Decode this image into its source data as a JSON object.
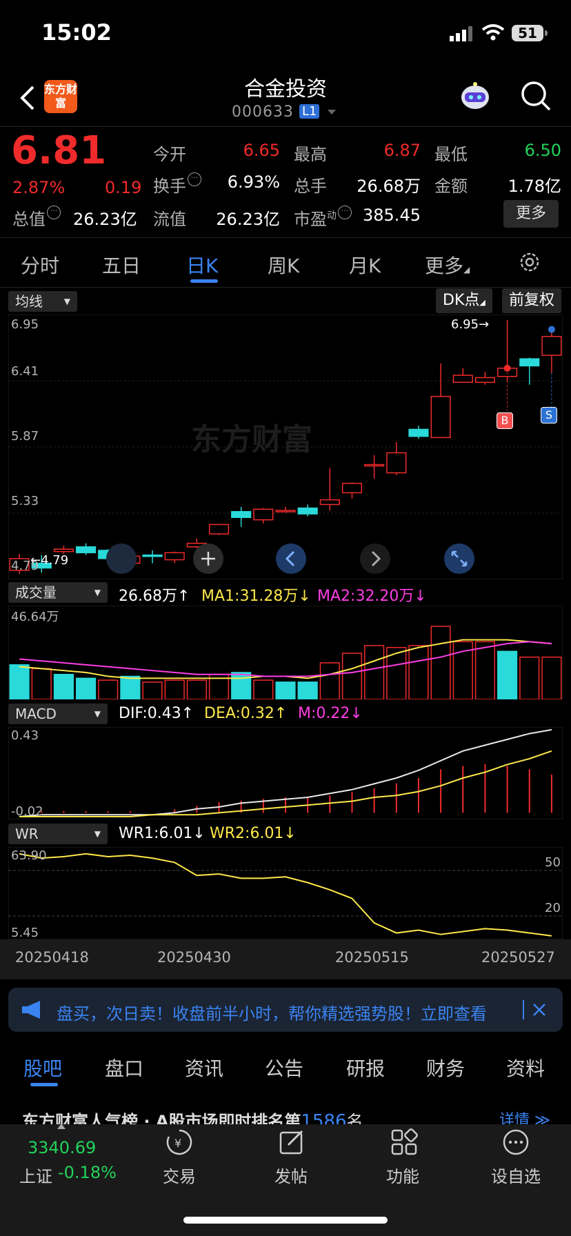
{
  "status": {
    "time": "15:02",
    "battery": "51"
  },
  "header": {
    "logo_text": "东方财富",
    "title": "合金投资",
    "code": "000633",
    "level_badge": "L1"
  },
  "quote": {
    "price": "6.81",
    "change_pct": "2.87%",
    "change": "0.19",
    "open_label": "今开",
    "open": "6.65",
    "high_label": "最高",
    "high": "6.87",
    "low_label": "最低",
    "low": "6.50",
    "turnover_label": "换手",
    "turnover": "6.93%",
    "volume_label": "总手",
    "volume": "26.68万",
    "amount_label": "金额",
    "amount": "1.78亿",
    "mcap_label": "总值",
    "mcap": "26.23亿",
    "float_label": "流值",
    "float": "26.23亿",
    "pe_label": "市盈",
    "pe_sup": "动",
    "pe": "385.45",
    "more": "更多"
  },
  "tabs": [
    "分时",
    "五日",
    "日K",
    "周K",
    "月K",
    "更多"
  ],
  "chart": {
    "ma_selector": "均线",
    "dk_button": "DK点",
    "fq_button": "前复权",
    "y_labels": [
      "6.95",
      "6.41",
      "5.87",
      "5.33",
      "4.79"
    ],
    "high_marker": "6.95→",
    "low_marker": "←4.79",
    "watermark": "东方财富",
    "volume": {
      "selector": "成交量",
      "vol": "26.68万↑",
      "ma1": "MA1:31.28万↓",
      "ma2": "MA2:32.20万↓",
      "max_label": "46.64万"
    },
    "macd": {
      "selector": "MACD",
      "dif": "DIF:0.43↑",
      "dea": "DEA:0.32↑",
      "m": "M:0.22↓",
      "top": "0.43",
      "bottom": "-0.02"
    },
    "wr": {
      "selector": "WR",
      "wr1": "WR1:6.01↓",
      "wr2": "WR2:6.01↓",
      "top": "63.90",
      "bottom": "5.45",
      "lvl50": "50",
      "lvl20": "20"
    },
    "dates": [
      "20250418",
      "20250430",
      "20250515",
      "20250527"
    ],
    "marker_b": "B",
    "marker_s": "S"
  },
  "chart_data": {
    "type": "candlestick",
    "candles": [
      {
        "o": 4.82,
        "c": 4.92,
        "h": 4.96,
        "l": 4.79
      },
      {
        "o": 4.88,
        "c": 4.84,
        "h": 4.95,
        "l": 4.8
      },
      {
        "o": 4.98,
        "c": 5.0,
        "h": 5.03,
        "l": 4.96
      },
      {
        "o": 5.02,
        "c": 4.97,
        "h": 5.05,
        "l": 4.95
      },
      {
        "o": 4.99,
        "c": 4.92,
        "h": 5.0,
        "l": 4.88
      },
      {
        "o": 4.88,
        "c": 4.94,
        "h": 4.95,
        "l": 4.84
      },
      {
        "o": 4.95,
        "c": 4.94,
        "h": 4.99,
        "l": 4.88
      },
      {
        "o": 4.91,
        "c": 4.97,
        "h": 4.98,
        "l": 4.88
      },
      {
        "o": 5.02,
        "c": 5.05,
        "h": 5.09,
        "l": 5.01
      },
      {
        "o": 5.13,
        "c": 5.21,
        "h": 5.21,
        "l": 5.12
      },
      {
        "o": 5.32,
        "c": 5.27,
        "h": 5.36,
        "l": 5.19
      },
      {
        "o": 5.25,
        "c": 5.34,
        "h": 5.35,
        "l": 5.22
      },
      {
        "o": 5.33,
        "c": 5.33,
        "h": 5.36,
        "l": 5.31
      },
      {
        "o": 5.35,
        "c": 5.3,
        "h": 5.38,
        "l": 5.28
      },
      {
        "o": 5.38,
        "c": 5.42,
        "h": 5.69,
        "l": 5.33
      },
      {
        "o": 5.48,
        "c": 5.56,
        "h": 5.57,
        "l": 5.43
      },
      {
        "o": 5.72,
        "c": 5.72,
        "h": 5.8,
        "l": 5.6
      },
      {
        "o": 5.65,
        "c": 5.82,
        "h": 5.91,
        "l": 5.63
      },
      {
        "o": 6.02,
        "c": 5.96,
        "h": 6.05,
        "l": 5.94
      },
      {
        "o": 5.95,
        "c": 6.3,
        "h": 6.58,
        "l": 5.95
      },
      {
        "o": 6.42,
        "c": 6.48,
        "h": 6.54,
        "l": 6.42
      },
      {
        "o": 6.42,
        "c": 6.46,
        "h": 6.51,
        "l": 6.4
      },
      {
        "o": 6.47,
        "c": 6.54,
        "h": 6.95,
        "l": 6.43
      },
      {
        "o": 6.62,
        "c": 6.56,
        "h": 6.63,
        "l": 6.4
      },
      {
        "o": 6.65,
        "c": 6.81,
        "h": 6.87,
        "l": 6.5
      }
    ],
    "ylim": [
      4.79,
      6.95
    ],
    "volume_max": 46.64,
    "volumes": [
      18,
      16,
      13,
      11,
      10,
      12,
      9,
      10,
      10,
      13,
      14,
      10,
      9,
      9,
      19,
      24,
      28,
      27,
      28,
      38,
      30,
      30,
      25,
      22,
      22
    ],
    "volume_up": [
      false,
      true,
      false,
      false,
      true,
      false,
      true,
      true,
      true,
      true,
      false,
      true,
      false,
      false,
      true,
      true,
      true,
      true,
      true,
      true,
      true,
      true,
      false,
      true,
      true
    ],
    "vol_ma1": [
      17,
      16,
      15,
      14,
      12,
      11,
      11,
      11,
      11,
      11,
      11,
      12,
      12,
      11,
      13,
      16,
      20,
      24,
      27,
      29,
      31,
      31,
      31,
      30,
      29
    ],
    "vol_ma2": [
      21,
      20,
      19,
      18,
      17,
      16,
      15,
      14,
      13,
      13,
      13,
      12,
      12,
      12,
      13,
      14,
      16,
      18,
      20,
      22,
      25,
      27,
      29,
      30,
      29
    ],
    "macd_dif": [
      -0.02,
      -0.01,
      -0.01,
      -0.01,
      -0.01,
      -0.01,
      -0.01,
      0.0,
      0.02,
      0.03,
      0.05,
      0.06,
      0.07,
      0.08,
      0.1,
      0.12,
      0.15,
      0.18,
      0.22,
      0.27,
      0.32,
      0.35,
      0.38,
      0.41,
      0.43
    ],
    "macd_dea": [
      -0.02,
      -0.02,
      -0.02,
      -0.02,
      -0.02,
      -0.02,
      -0.01,
      -0.01,
      -0.01,
      0.0,
      0.01,
      0.02,
      0.03,
      0.04,
      0.05,
      0.06,
      0.08,
      0.09,
      0.11,
      0.14,
      0.18,
      0.21,
      0.25,
      0.28,
      0.32
    ],
    "macd_m": [
      0.0,
      0.01,
      0.01,
      0.01,
      0.01,
      0.01,
      0.0,
      0.02,
      0.04,
      0.06,
      0.07,
      0.08,
      0.09,
      0.09,
      0.1,
      0.12,
      0.14,
      0.17,
      0.2,
      0.25,
      0.27,
      0.28,
      0.27,
      0.25,
      0.22
    ],
    "wr": [
      63,
      60,
      61,
      63,
      61,
      62,
      60,
      57,
      48,
      49,
      46,
      46,
      47,
      43,
      38,
      32,
      15,
      8,
      10,
      7,
      9,
      11,
      10,
      8,
      6
    ],
    "wr_ylim": [
      5.45,
      63.9
    ]
  },
  "banner": {
    "text": "盘买，次日卖！收盘前半小时，帮你精选强势股！立即查看"
  },
  "bottom_tabs": [
    "股吧",
    "盘口",
    "资讯",
    "公告",
    "研报",
    "财务",
    "资料"
  ],
  "rank": {
    "prefix": "东方财富人气榜 · A股市场即时排名第",
    "num": "1586",
    "suffix": "名",
    "detail": "详情 ≫"
  },
  "dock": {
    "index_value": "3340.69",
    "index_name": "上证",
    "index_change": "-0.18%",
    "items": [
      "交易",
      "发帖",
      "功能",
      "设自选"
    ]
  }
}
